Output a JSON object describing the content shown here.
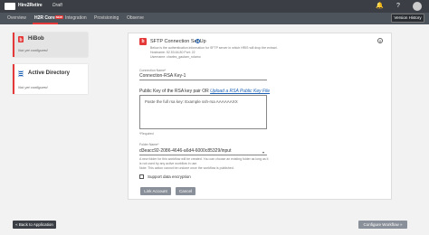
{
  "header": {
    "app_title": "Hire2Retire",
    "status": "Draft",
    "icons": [
      "bell-icon",
      "help-icon",
      "avatar"
    ]
  },
  "nav": {
    "tabs": [
      {
        "label": "Overview",
        "active": false
      },
      {
        "label": "H2R Core",
        "active": true,
        "badge": "NEW"
      },
      {
        "label": "Integration",
        "active": false
      },
      {
        "label": "Provisioning",
        "active": false
      },
      {
        "label": "Observe",
        "active": false
      }
    ],
    "version_button": "Version History"
  },
  "cards": [
    {
      "title": "HiBob",
      "subtitle": "Not yet configured",
      "icon": "hibob-logo-icon"
    },
    {
      "title": "Active Directory",
      "subtitle": "Not yet configured",
      "icon": "active-directory-logo-icon"
    }
  ],
  "panel": {
    "title": "SFTP Connection Set Up",
    "info_lines": [
      "Below is the authentication information for SFTP server in which HRIS will drop the extract.",
      "Hostname: 52.53.64.80   Port: 22",
      "Username: charles_gautam_rolamo"
    ],
    "connection_name_label": "Connection Name*",
    "connection_name_value": "Connection-RSA Key-1",
    "key_label": "Public Key of the RSA key pair OR",
    "upload_link": "Upload a RSA Public Key File",
    "textarea_placeholder": "Paste the full rsa key: Example ssh-rsa AAAAAAXX",
    "required_note": "*Required",
    "folder_name_label": "Folder Name*",
    "folder_name_value": "d3eacc92-2086-4646-a6d4-6000c85329/input",
    "note_lines": [
      "A new folder for this workflow will be created. You can choose an existing folder as long as it",
      "is not used by any active workflow in use.",
      "Note: This action cannot be undone once the workflow is published."
    ],
    "checkbox_label": "Support data encryption",
    "link_account_button": "Link Account",
    "cancel_button": "Cancel"
  },
  "footer": {
    "back_button": "« Back to Application",
    "configure_button": "Configure Workflow »"
  },
  "colors": {
    "accent": "#e53939",
    "header_bg": "#3b3f45",
    "nav_bg": "#4e545b",
    "button_gray": "#8a9099",
    "link": "#1a5fb4"
  }
}
